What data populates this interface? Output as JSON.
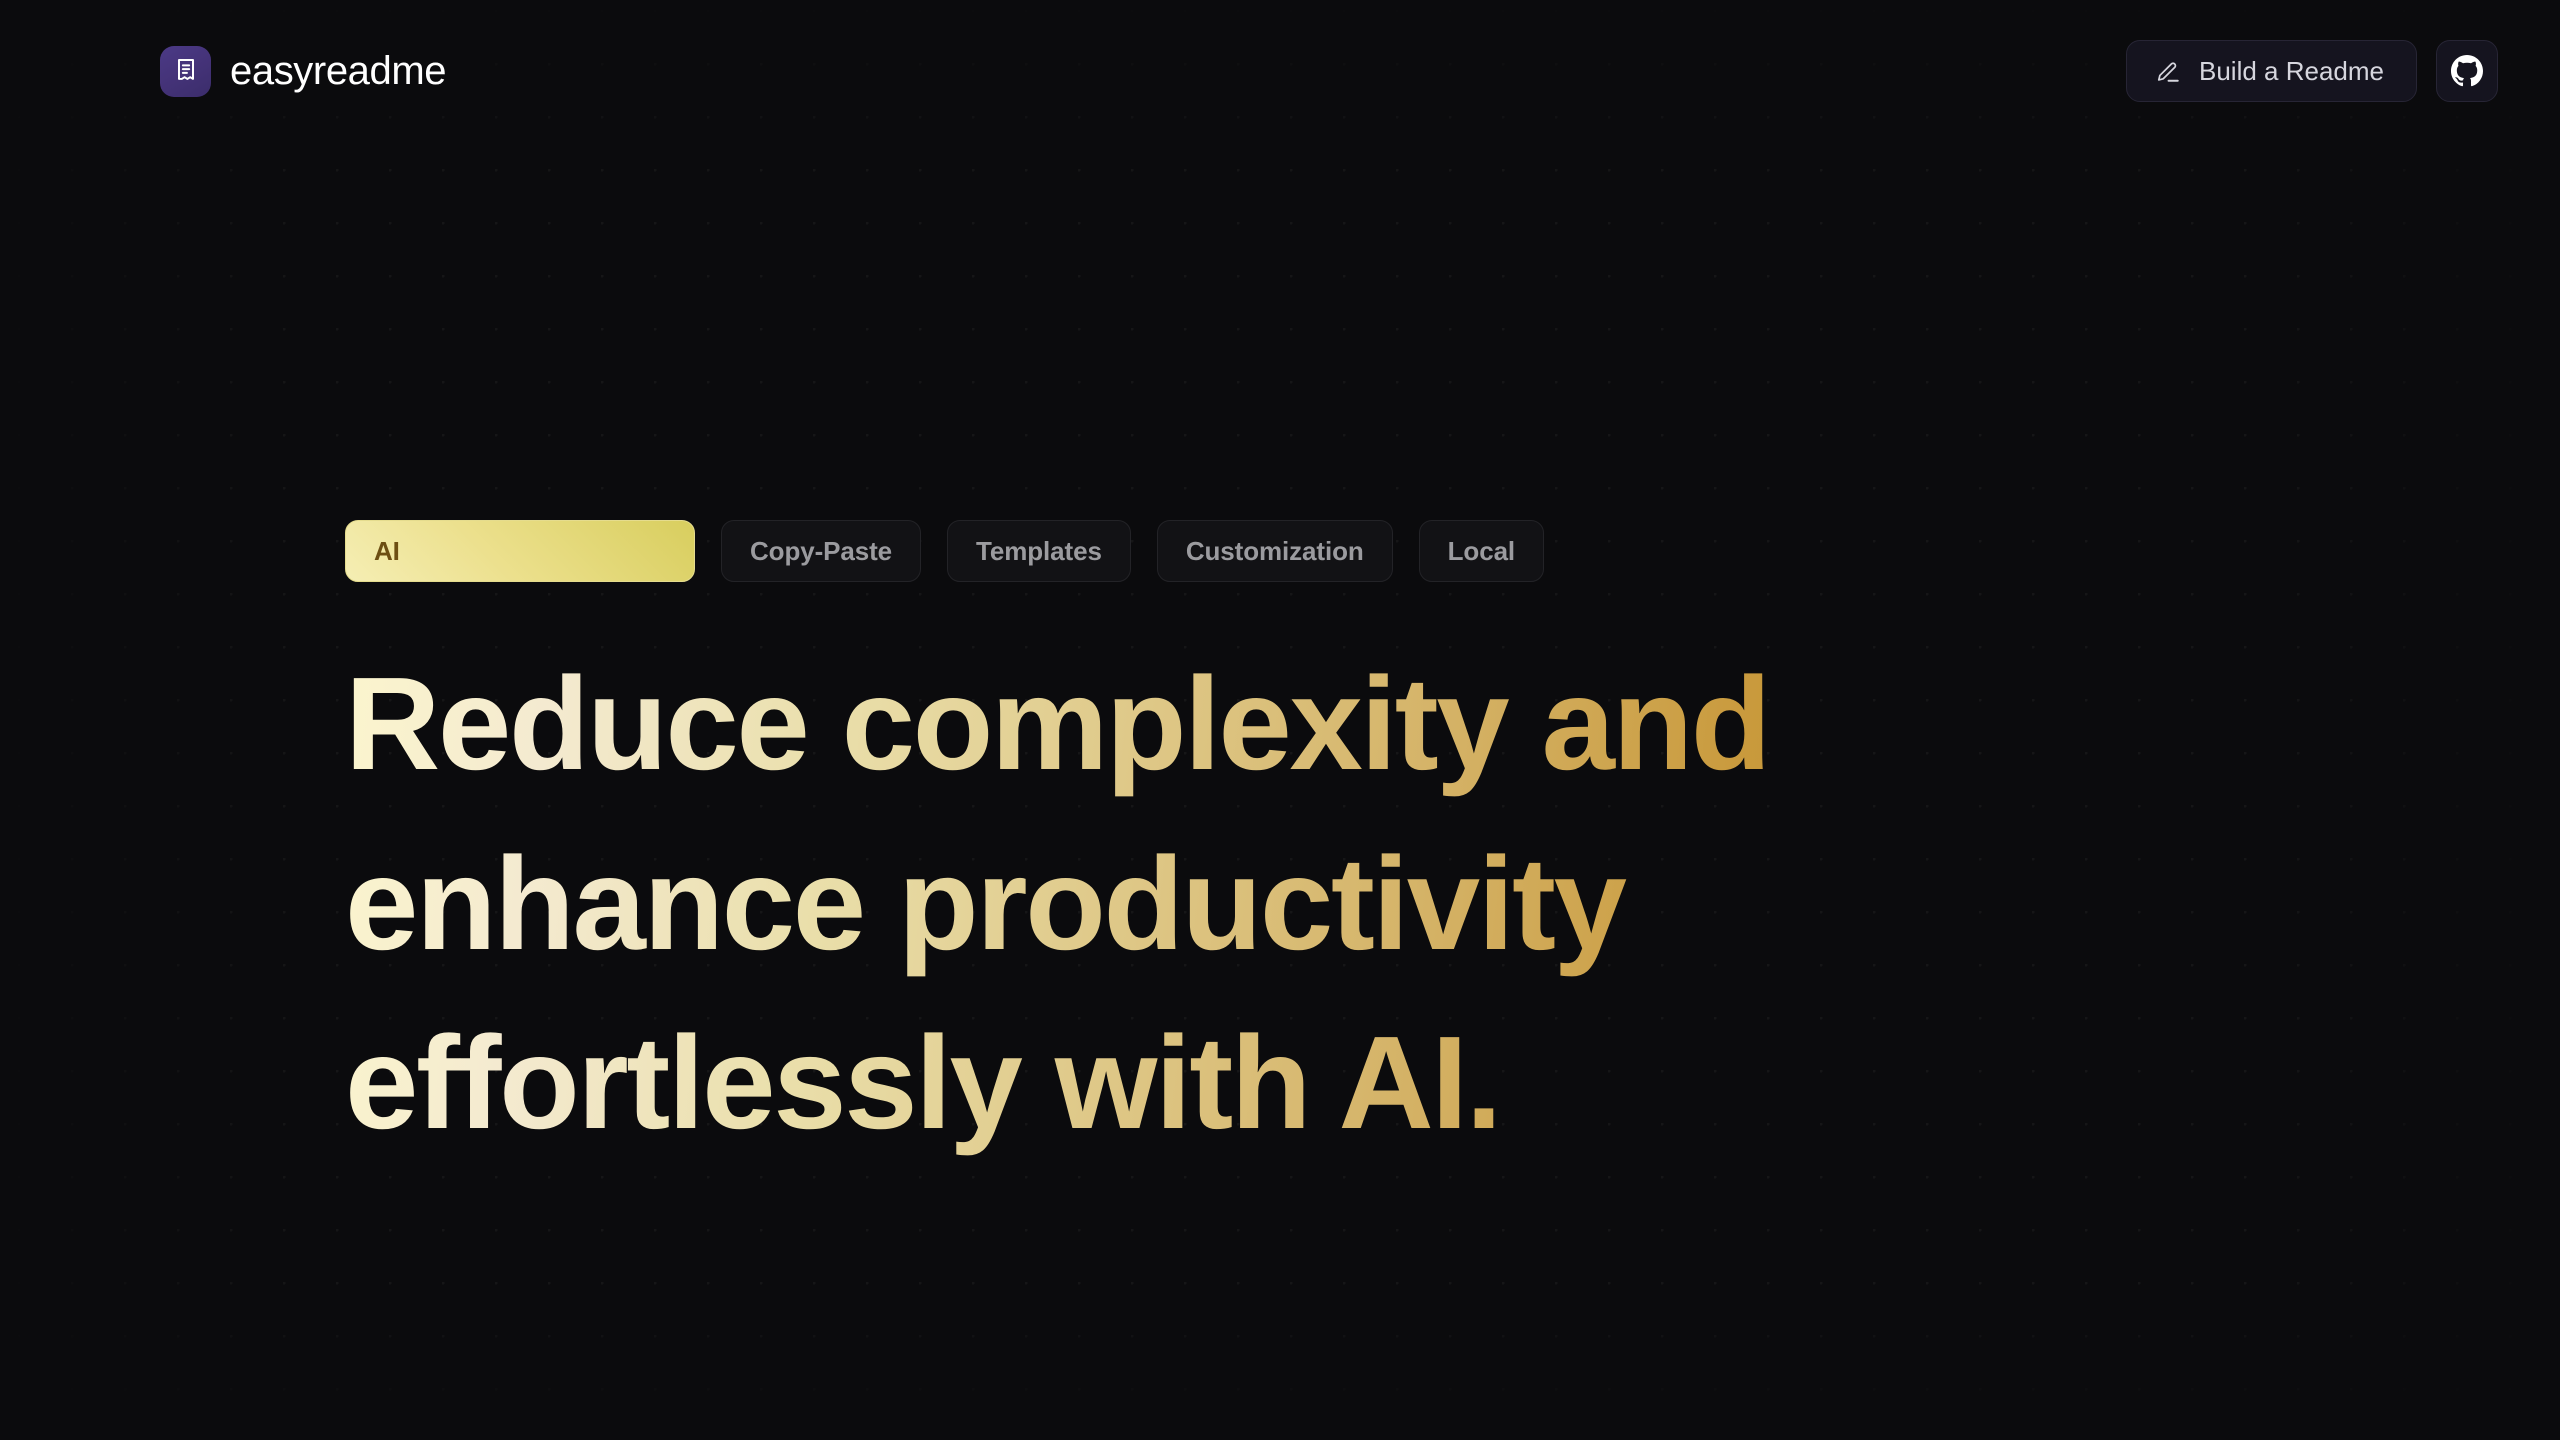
{
  "background": {
    "page_color": "#0b0b0d",
    "dot_grid": true
  },
  "header": {
    "brand": {
      "name": "easyreadme",
      "logo_icon": "document-receipt-icon",
      "logo_color": "#453379"
    },
    "actions": {
      "build_readme": {
        "label": "Build a Readme",
        "icon": "pen-edit-icon"
      },
      "github": {
        "icon": "github-icon",
        "label": ""
      }
    }
  },
  "hero": {
    "tabs": [
      {
        "label": "AI",
        "active": true
      },
      {
        "label": "Copy-Paste",
        "active": false
      },
      {
        "label": "Templates",
        "active": false
      },
      {
        "label": "Customization",
        "active": false
      },
      {
        "label": "Local",
        "active": false
      }
    ],
    "active_tab_index": 0,
    "headline": "Reduce complexity and enhance productivity effortlessly with AI.",
    "headline_gradient_from": "#fbf5cd",
    "headline_gradient_to": "#bd8a25",
    "accent_color": "#ece08d"
  }
}
